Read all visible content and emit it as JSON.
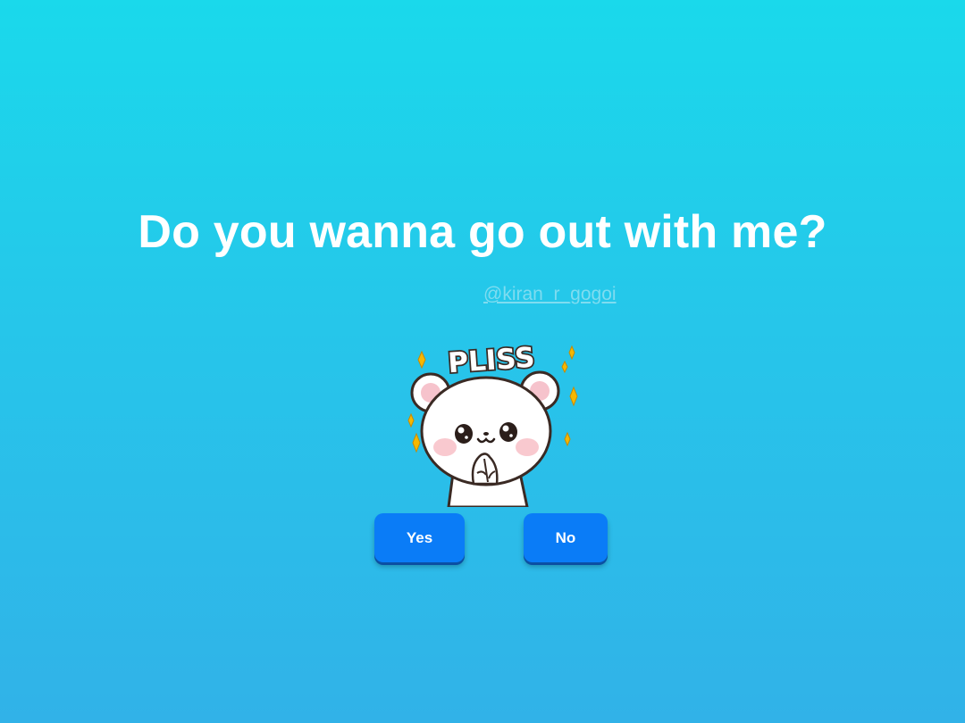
{
  "question": "Do you wanna go out with me?",
  "handle": "@kiran_r_gogoi",
  "sticker": {
    "text": "PLISS",
    "icon": "pleading-bear-sticker"
  },
  "buttons": {
    "yes": "Yes",
    "no": "No"
  },
  "colors": {
    "background_top": "#1ad9eb",
    "background_bottom": "#31b2e8",
    "button": "#0a7cf7",
    "sparkle": "#f5b800"
  }
}
